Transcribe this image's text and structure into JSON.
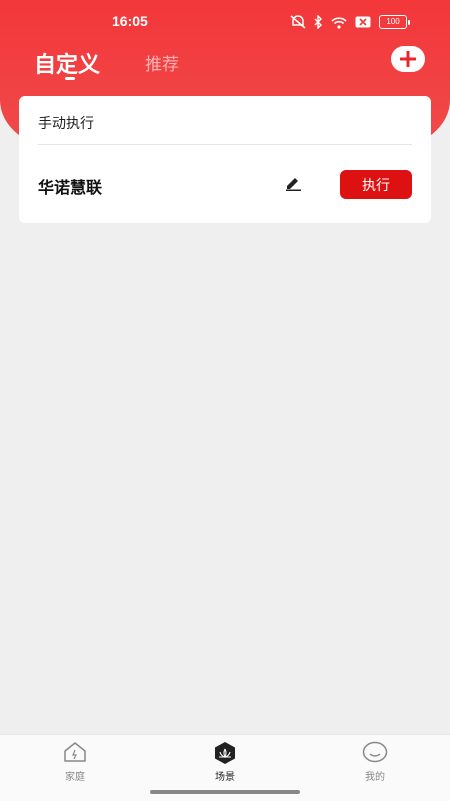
{
  "status_bar": {
    "time": "16:05",
    "battery": "100",
    "icons": [
      "silent-icon",
      "bluetooth-icon",
      "wifi-icon",
      "sim-x-icon",
      "battery-icon"
    ]
  },
  "header": {
    "tabs": [
      {
        "label": "自定义",
        "active": true
      },
      {
        "label": "推荐",
        "active": false
      }
    ],
    "add_icon": "plus-icon"
  },
  "card": {
    "section_title": "手动执行",
    "scene_name": "华诺慧联",
    "edit_icon": "pencil-icon",
    "run_label": "执行"
  },
  "bottom_nav": {
    "items": [
      {
        "label": "家庭",
        "icon": "home-icon",
        "active": false
      },
      {
        "label": "场景",
        "icon": "scene-icon",
        "active": true
      },
      {
        "label": "我的",
        "icon": "profile-icon",
        "active": false
      }
    ]
  },
  "colors": {
    "brand_red": "#f3373a",
    "button_red": "#dd1111",
    "background": "#efefef"
  }
}
